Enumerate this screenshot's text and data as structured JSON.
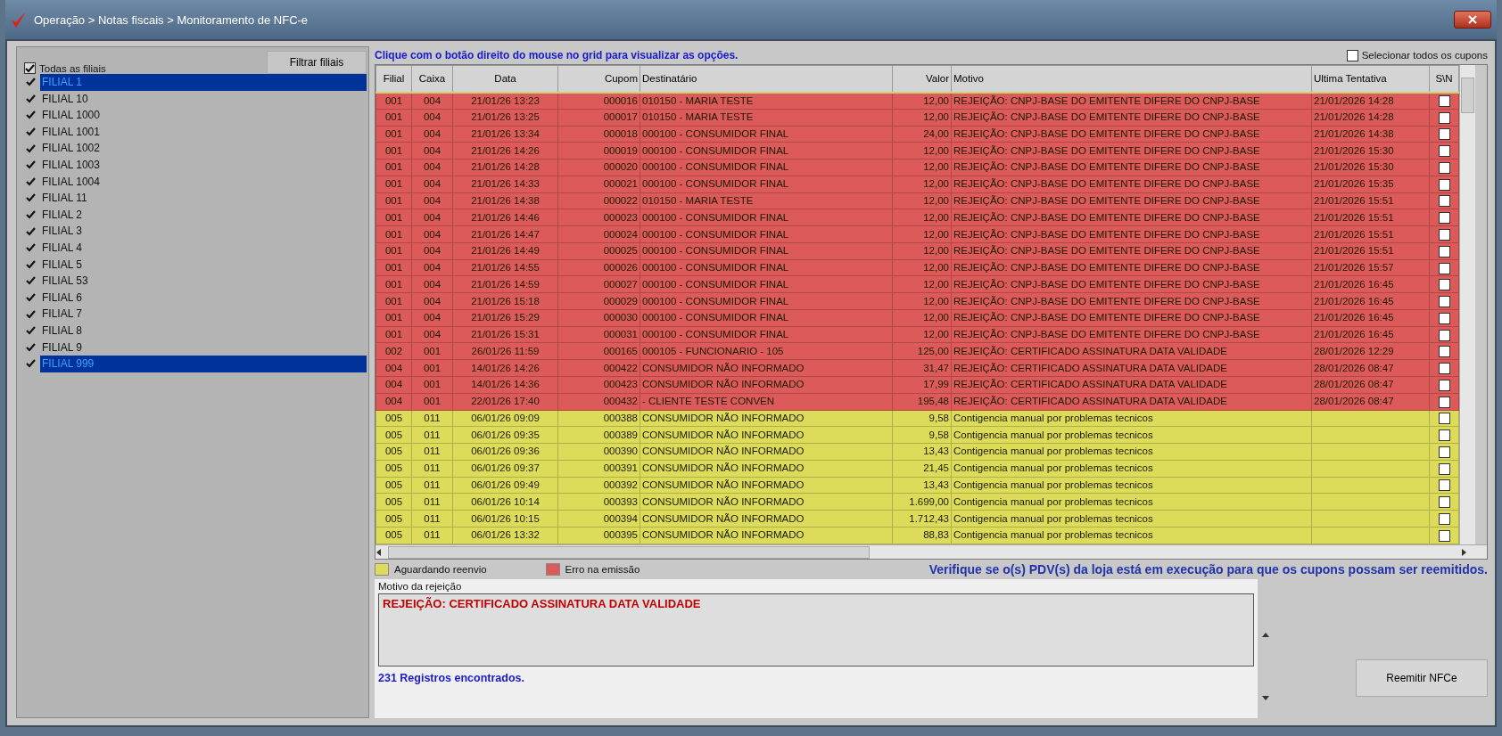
{
  "window": {
    "title": "Operação > Notas fiscais > Monitoramento de NFC-e"
  },
  "sidebar": {
    "filter_button": "Filtrar filiais",
    "all": {
      "label": "Todas as filiais",
      "checked": true
    },
    "items": [
      {
        "label": "FILIAL 1",
        "checked": true,
        "selected": true
      },
      {
        "label": "FILIAL 10",
        "checked": true,
        "selected": false
      },
      {
        "label": "FILIAL 1000",
        "checked": true,
        "selected": false
      },
      {
        "label": "FILIAL 1001",
        "checked": true,
        "selected": false
      },
      {
        "label": "FILIAL 1002",
        "checked": true,
        "selected": false
      },
      {
        "label": "FILIAL 1003",
        "checked": true,
        "selected": false
      },
      {
        "label": "FILIAL 1004",
        "checked": true,
        "selected": false
      },
      {
        "label": "FILIAL 11",
        "checked": true,
        "selected": false
      },
      {
        "label": "FILIAL 2",
        "checked": true,
        "selected": false
      },
      {
        "label": "FILIAL 3",
        "checked": true,
        "selected": false
      },
      {
        "label": "FILIAL 4",
        "checked": true,
        "selected": false
      },
      {
        "label": "FILIAL 5",
        "checked": true,
        "selected": false
      },
      {
        "label": "FILIAL 53",
        "checked": true,
        "selected": false
      },
      {
        "label": "FILIAL 6",
        "checked": true,
        "selected": false
      },
      {
        "label": "FILIAL 7",
        "checked": true,
        "selected": false
      },
      {
        "label": "FILIAL 8",
        "checked": true,
        "selected": false
      },
      {
        "label": "FILIAL 9",
        "checked": true,
        "selected": false
      },
      {
        "label": "FILIAL 999",
        "checked": true,
        "selected": true
      }
    ]
  },
  "hint": "Clique com o botão direito do mouse no grid para visualizar as opções.",
  "select_all": {
    "label": "Selecionar todos os cupons",
    "checked": false
  },
  "table": {
    "columns": [
      "Filial",
      "Caixa",
      "Data",
      "Cupom",
      "Destinatário",
      "Valor",
      "Motivo",
      "Ultima Tentativa",
      "S\\N"
    ],
    "rows": [
      {
        "color": "#dc5a5a",
        "cells": [
          "001",
          "004",
          "21/01/26 13:23",
          "000016",
          "010150 - MARIA TESTE",
          "12,00",
          "REJEIÇÃO: CNPJ-BASE DO EMITENTE DIFERE DO CNPJ-BASE",
          "21/01/2026 14:28"
        ],
        "checked": false
      },
      {
        "color": "#dc5a5a",
        "cells": [
          "001",
          "004",
          "21/01/26 13:25",
          "000017",
          "010150 - MARIA TESTE",
          "12,00",
          "REJEIÇÃO: CNPJ-BASE DO EMITENTE DIFERE DO CNPJ-BASE",
          "21/01/2026 14:28"
        ],
        "checked": false
      },
      {
        "color": "#dc5a5a",
        "cells": [
          "001",
          "004",
          "21/01/26 13:34",
          "000018",
          "000100 - CONSUMIDOR FINAL",
          "24,00",
          "REJEIÇÃO: CNPJ-BASE DO EMITENTE DIFERE DO CNPJ-BASE",
          "21/01/2026 14:38"
        ],
        "checked": false
      },
      {
        "color": "#dc5a5a",
        "cells": [
          "001",
          "004",
          "21/01/26 14:26",
          "000019",
          "000100 - CONSUMIDOR FINAL",
          "12,00",
          "REJEIÇÃO: CNPJ-BASE DO EMITENTE DIFERE DO CNPJ-BASE",
          "21/01/2026 15:30"
        ],
        "checked": false
      },
      {
        "color": "#dc5a5a",
        "cells": [
          "001",
          "004",
          "21/01/26 14:28",
          "000020",
          "000100 - CONSUMIDOR FINAL",
          "12,00",
          "REJEIÇÃO: CNPJ-BASE DO EMITENTE DIFERE DO CNPJ-BASE",
          "21/01/2026 15:30"
        ],
        "checked": false
      },
      {
        "color": "#dc5a5a",
        "cells": [
          "001",
          "004",
          "21/01/26 14:33",
          "000021",
          "000100 - CONSUMIDOR FINAL",
          "12,00",
          "REJEIÇÃO: CNPJ-BASE DO EMITENTE DIFERE DO CNPJ-BASE",
          "21/01/2026 15:35"
        ],
        "checked": false
      },
      {
        "color": "#dc5a5a",
        "cells": [
          "001",
          "004",
          "21/01/26 14:38",
          "000022",
          "010150 - MARIA TESTE",
          "12,00",
          "REJEIÇÃO: CNPJ-BASE DO EMITENTE DIFERE DO CNPJ-BASE",
          "21/01/2026 15:51"
        ],
        "checked": false
      },
      {
        "color": "#dc5a5a",
        "cells": [
          "001",
          "004",
          "21/01/26 14:46",
          "000023",
          "000100 - CONSUMIDOR FINAL",
          "12,00",
          "REJEIÇÃO: CNPJ-BASE DO EMITENTE DIFERE DO CNPJ-BASE",
          "21/01/2026 15:51"
        ],
        "checked": false
      },
      {
        "color": "#dc5a5a",
        "cells": [
          "001",
          "004",
          "21/01/26 14:47",
          "000024",
          "000100 - CONSUMIDOR FINAL",
          "12,00",
          "REJEIÇÃO: CNPJ-BASE DO EMITENTE DIFERE DO CNPJ-BASE",
          "21/01/2026 15:51"
        ],
        "checked": false
      },
      {
        "color": "#dc5a5a",
        "cells": [
          "001",
          "004",
          "21/01/26 14:49",
          "000025",
          "000100 - CONSUMIDOR FINAL",
          "12,00",
          "REJEIÇÃO: CNPJ-BASE DO EMITENTE DIFERE DO CNPJ-BASE",
          "21/01/2026 15:51"
        ],
        "checked": false
      },
      {
        "color": "#dc5a5a",
        "cells": [
          "001",
          "004",
          "21/01/26 14:55",
          "000026",
          "000100 - CONSUMIDOR FINAL",
          "12,00",
          "REJEIÇÃO: CNPJ-BASE DO EMITENTE DIFERE DO CNPJ-BASE",
          "21/01/2026 15:57"
        ],
        "checked": false
      },
      {
        "color": "#dc5a5a",
        "cells": [
          "001",
          "004",
          "21/01/26 14:59",
          "000027",
          "000100 - CONSUMIDOR FINAL",
          "12,00",
          "REJEIÇÃO: CNPJ-BASE DO EMITENTE DIFERE DO CNPJ-BASE",
          "21/01/2026 16:45"
        ],
        "checked": false
      },
      {
        "color": "#dc5a5a",
        "cells": [
          "001",
          "004",
          "21/01/26 15:18",
          "000029",
          "000100 - CONSUMIDOR FINAL",
          "12,00",
          "REJEIÇÃO: CNPJ-BASE DO EMITENTE DIFERE DO CNPJ-BASE",
          "21/01/2026 16:45"
        ],
        "checked": false
      },
      {
        "color": "#dc5a5a",
        "cells": [
          "001",
          "004",
          "21/01/26 15:29",
          "000030",
          "000100 - CONSUMIDOR FINAL",
          "12,00",
          "REJEIÇÃO: CNPJ-BASE DO EMITENTE DIFERE DO CNPJ-BASE",
          "21/01/2026 16:45"
        ],
        "checked": false
      },
      {
        "color": "#dc5a5a",
        "cells": [
          "001",
          "004",
          "21/01/26 15:31",
          "000031",
          "000100 - CONSUMIDOR FINAL",
          "12,00",
          "REJEIÇÃO: CNPJ-BASE DO EMITENTE DIFERE DO CNPJ-BASE",
          "21/01/2026 16:45"
        ],
        "checked": false
      },
      {
        "color": "#dc5a5a",
        "cells": [
          "002",
          "001",
          "26/01/26 11:59",
          "000165",
          "000105 - FUNCIONARIO - 105",
          "125,00",
          "REJEIÇÃO: CERTIFICADO ASSINATURA DATA VALIDADE",
          "28/01/2026 12:29"
        ],
        "checked": false
      },
      {
        "color": "#dc5a5a",
        "cells": [
          "004",
          "001",
          "14/01/26 14:26",
          "000422",
          "CONSUMIDOR NÃO INFORMADO",
          "31,47",
          "REJEIÇÃO: CERTIFICADO ASSINATURA DATA VALIDADE",
          "28/01/2026 08:47"
        ],
        "checked": false
      },
      {
        "color": "#dc5a5a",
        "cells": [
          "004",
          "001",
          "14/01/26 14:36",
          "000423",
          "CONSUMIDOR NÃO INFORMADO",
          "17,99",
          "REJEIÇÃO: CERTIFICADO ASSINATURA DATA VALIDADE",
          "28/01/2026 08:47"
        ],
        "checked": false
      },
      {
        "color": "#dc5a5a",
        "cells": [
          "004",
          "001",
          "22/01/26 17:40",
          "000432",
          "- CLIENTE TESTE CONVEN",
          "195,48",
          "REJEIÇÃO: CERTIFICADO ASSINATURA DATA VALIDADE",
          "28/01/2026 08:47"
        ],
        "checked": false
      },
      {
        "color": "#dcdc5a",
        "cells": [
          "005",
          "011",
          "06/01/26 09:09",
          "000388",
          "CONSUMIDOR NÃO INFORMADO",
          "9,58",
          "Contigencia manual por problemas tecnicos",
          ""
        ],
        "checked": false
      },
      {
        "color": "#dcdc5a",
        "cells": [
          "005",
          "011",
          "06/01/26 09:35",
          "000389",
          "CONSUMIDOR NÃO INFORMADO",
          "9,58",
          "Contigencia manual por problemas tecnicos",
          ""
        ],
        "checked": false
      },
      {
        "color": "#dcdc5a",
        "cells": [
          "005",
          "011",
          "06/01/26 09:36",
          "000390",
          "CONSUMIDOR NÃO INFORMADO",
          "13,43",
          "Contigencia manual por problemas tecnicos",
          ""
        ],
        "checked": false
      },
      {
        "color": "#dcdc5a",
        "cells": [
          "005",
          "011",
          "06/01/26 09:37",
          "000391",
          "CONSUMIDOR NÃO INFORMADO",
          "21,45",
          "Contigencia manual por problemas tecnicos",
          ""
        ],
        "checked": false
      },
      {
        "color": "#dcdc5a",
        "cells": [
          "005",
          "011",
          "06/01/26 09:49",
          "000392",
          "CONSUMIDOR NÃO INFORMADO",
          "13,43",
          "Contigencia manual por problemas tecnicos",
          ""
        ],
        "checked": false
      },
      {
        "color": "#dcdc5a",
        "cells": [
          "005",
          "011",
          "06/01/26 10:14",
          "000393",
          "CONSUMIDOR NÃO INFORMADO",
          "1.699,00",
          "Contigencia manual por problemas tecnicos",
          ""
        ],
        "checked": false
      },
      {
        "color": "#dcdc5a",
        "cells": [
          "005",
          "011",
          "06/01/26 10:15",
          "000394",
          "CONSUMIDOR NÃO INFORMADO",
          "1.712,43",
          "Contigencia manual por problemas tecnicos",
          ""
        ],
        "checked": false
      },
      {
        "color": "#dcdc5a",
        "cells": [
          "005",
          "011",
          "06/01/26 13:32",
          "000395",
          "CONSUMIDOR NÃO INFORMADO",
          "88,83",
          "Contigencia manual por problemas tecnicos",
          ""
        ],
        "checked": false
      }
    ]
  },
  "legend": [
    {
      "label": "Aguardando reenvio",
      "color": "#dcdc5a"
    },
    {
      "label": "Erro na emissão",
      "color": "#dc5a5a"
    }
  ],
  "notice": "Verifique se o(s) PDV(s) da loja está em execução para que os cupons possam ser reemitidos.",
  "rejection": {
    "label": "Motivo da rejeição",
    "value": "REJEIÇÃO: CERTIFICADO ASSINATURA DATA VALIDADE"
  },
  "record_count": "231 Registros encontrados.",
  "reissue_button": "Reemitir NFCe"
}
